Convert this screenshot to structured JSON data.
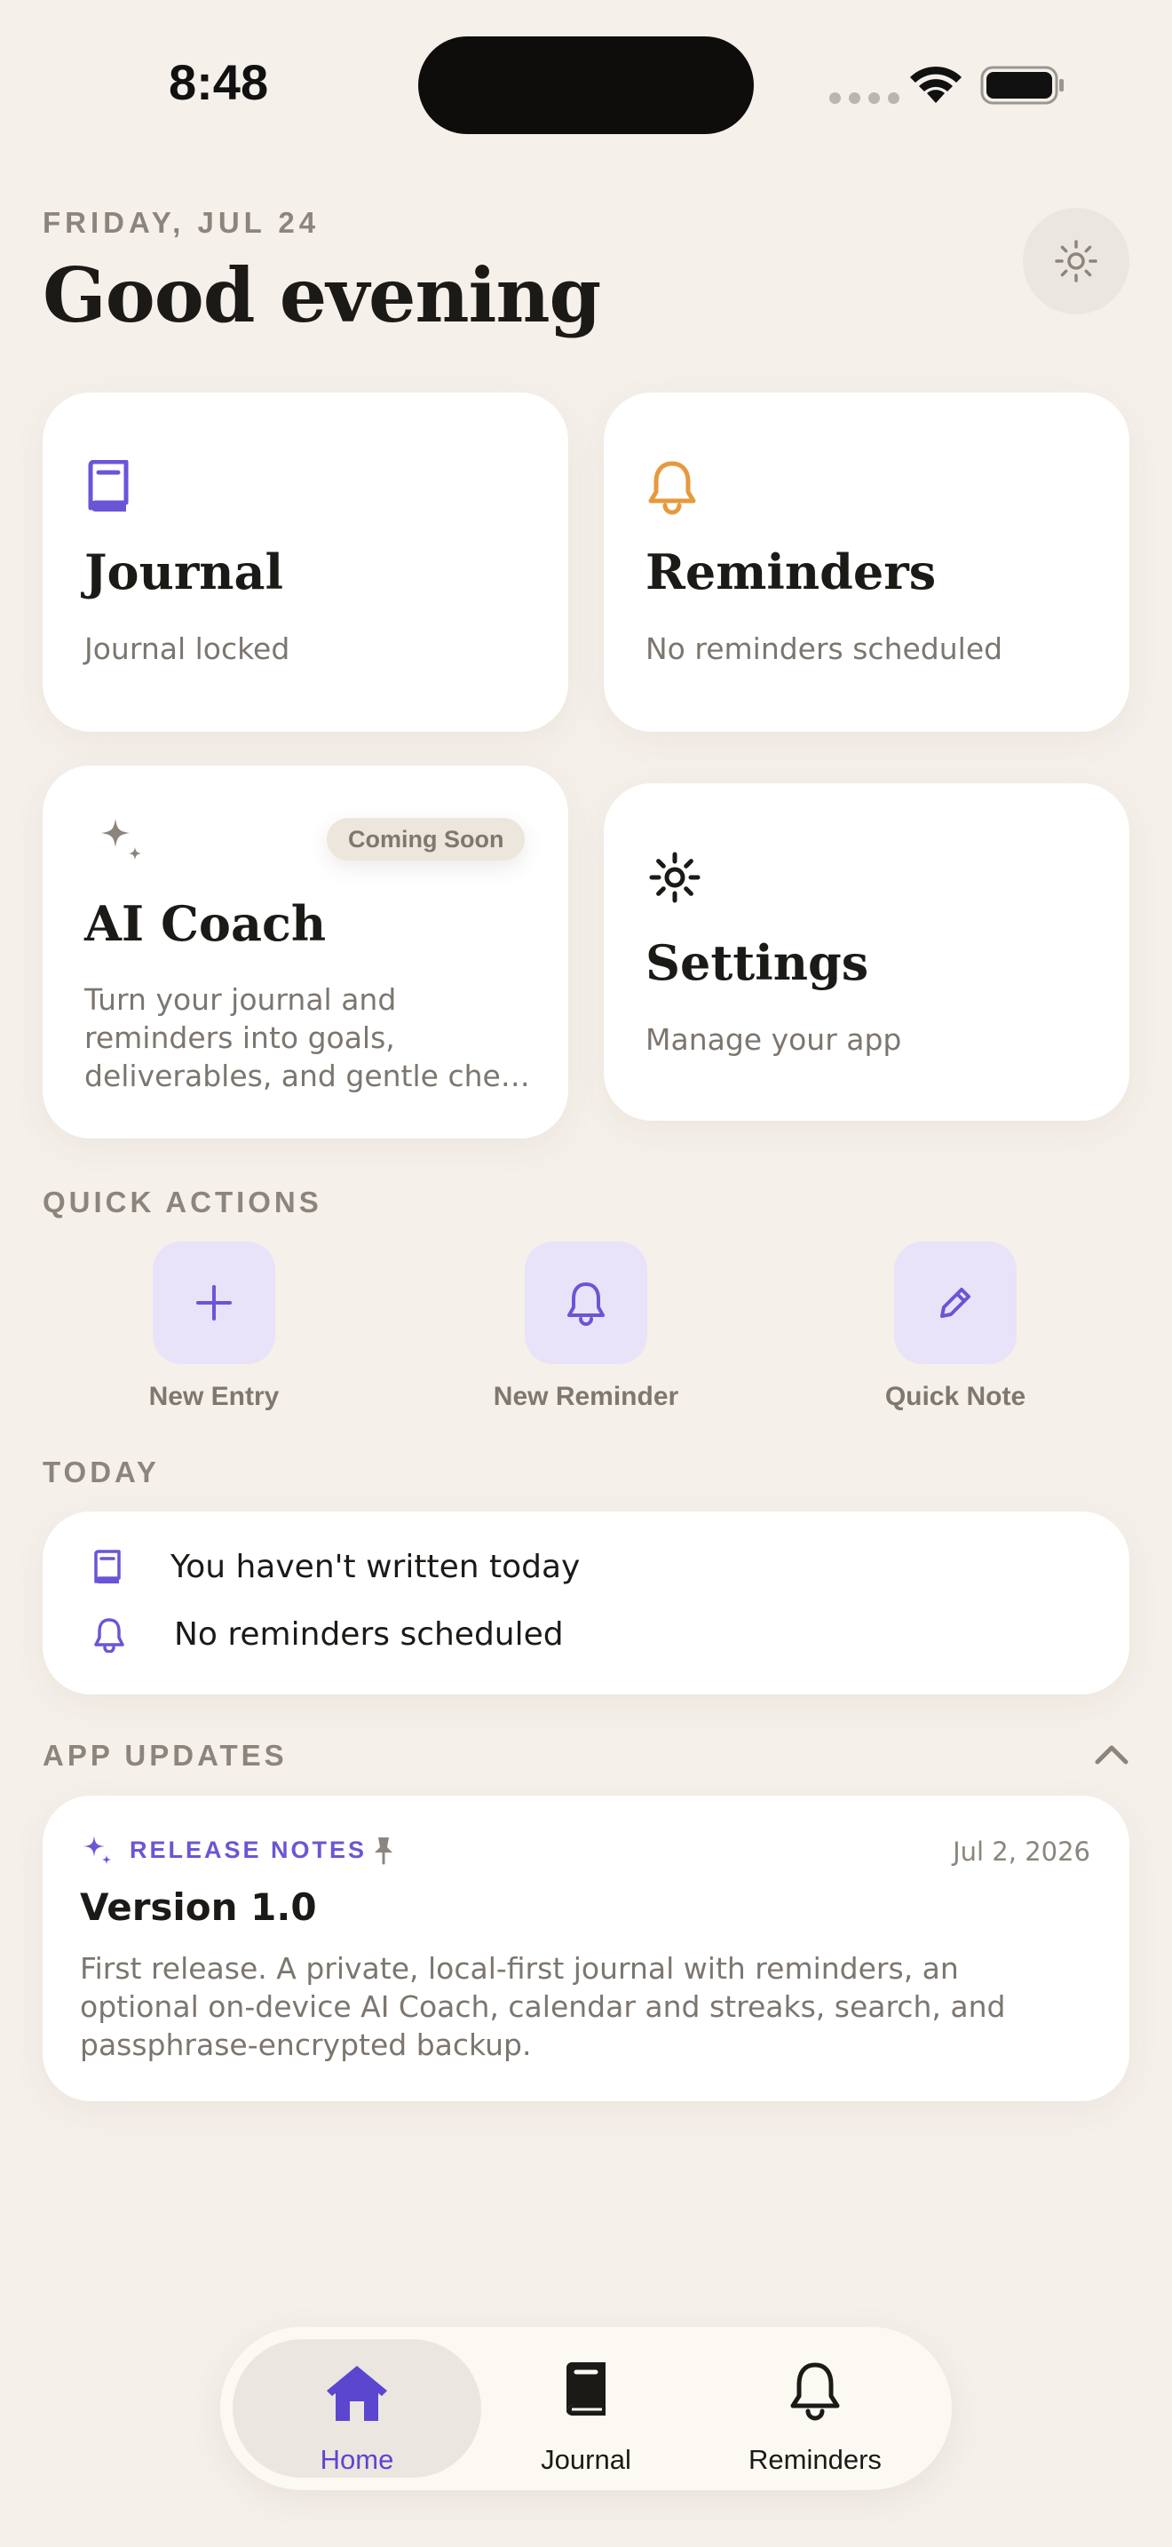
{
  "status_bar": {
    "time": "8:48"
  },
  "header": {
    "date": "FRIDAY, JUL 24",
    "greeting": "Good evening",
    "theme_icon": "sun-icon"
  },
  "cards": {
    "journal": {
      "title": "Journal",
      "subtitle": "Journal locked",
      "icon": "book-icon"
    },
    "reminders": {
      "title": "Reminders",
      "subtitle": "No reminders scheduled",
      "icon": "bell-icon"
    },
    "ai_coach": {
      "title": "AI Coach",
      "subtitle": "Turn your journal and reminders into goals, deliverables, and gentle che…",
      "badge": "Coming Soon",
      "icon": "sparkle-icon"
    },
    "settings": {
      "title": "Settings",
      "subtitle": "Manage your app",
      "icon": "gear-icon"
    }
  },
  "quick_actions": {
    "label": "QUICK ACTIONS",
    "items": [
      {
        "label": "New Entry",
        "icon": "plus-icon"
      },
      {
        "label": "New Reminder",
        "icon": "bell-icon"
      },
      {
        "label": "Quick Note",
        "icon": "pencil-icon"
      }
    ]
  },
  "today": {
    "label": "TODAY",
    "rows": [
      {
        "text": "You haven't written today",
        "icon": "book-icon"
      },
      {
        "text": "No reminders scheduled",
        "icon": "bell-icon"
      }
    ]
  },
  "updates": {
    "label": "APP UPDATES",
    "release": {
      "tag": "RELEASE NOTES",
      "date": "Jul 2, 2026",
      "title": "Version 1.0",
      "body": "First release. A private, local-first journal with reminders, an optional on-device AI Coach, calendar and streaks, search, and passphrase-encrypted backup."
    }
  },
  "tabbar": {
    "tabs": [
      {
        "label": "Home",
        "icon": "home-icon",
        "active": true
      },
      {
        "label": "Journal",
        "icon": "book-icon",
        "active": false
      },
      {
        "label": "Reminders",
        "icon": "bell-icon",
        "active": false
      }
    ]
  },
  "colors": {
    "background": "#f5f0ea",
    "accent": "#6b55d6",
    "reminder_accent": "#e59a3c",
    "muted_text": "#8b857d"
  }
}
